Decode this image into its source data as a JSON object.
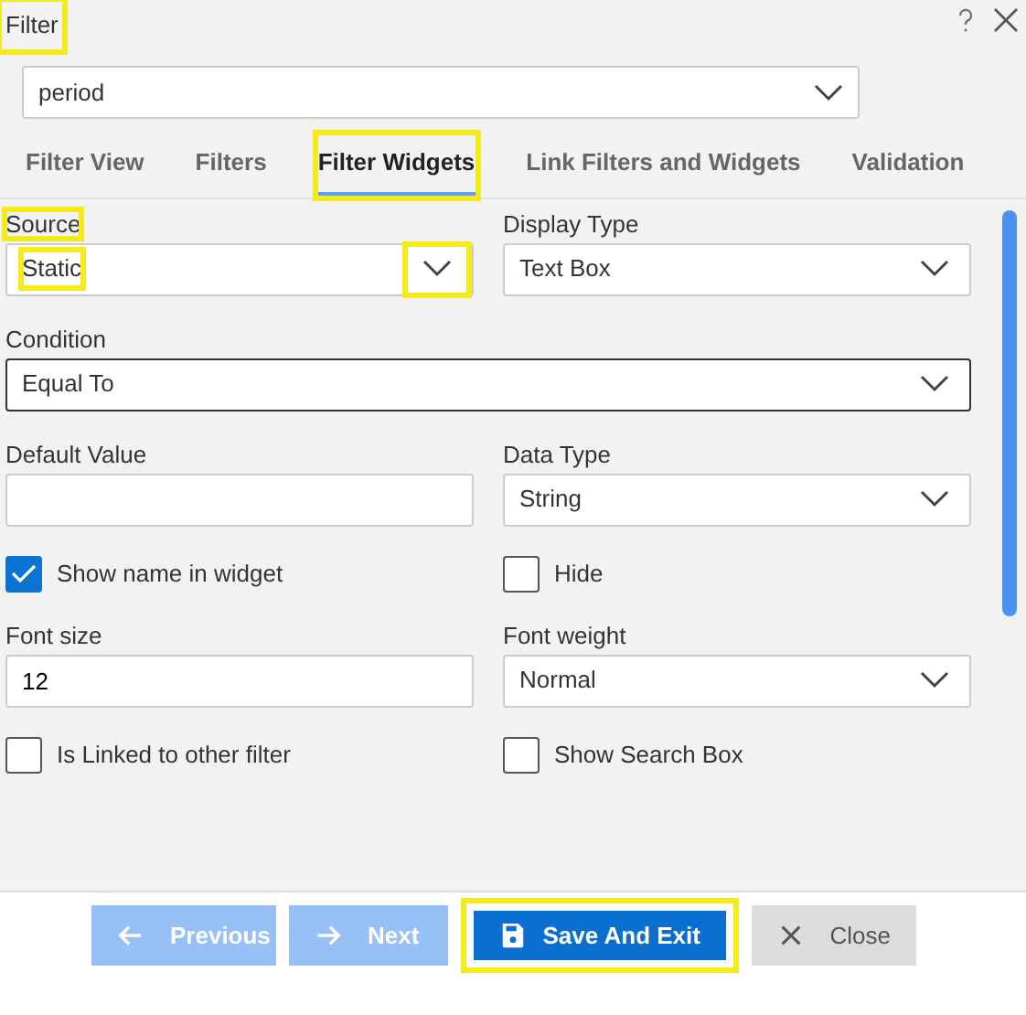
{
  "window": {
    "title": "Filter",
    "highlighted": true
  },
  "filter_select": {
    "value": "period"
  },
  "tabs": [
    {
      "label": "Filter View",
      "selected": false
    },
    {
      "label": "Filters",
      "selected": false
    },
    {
      "label": "Filter Widgets",
      "selected": true,
      "highlighted": true
    },
    {
      "label": "Link Filters and Widgets",
      "selected": false
    },
    {
      "label": "Validation",
      "selected": false
    }
  ],
  "fields": [
    {
      "kind": "select",
      "label": "Source",
      "value": "Static",
      "highlighted": true
    },
    {
      "kind": "select",
      "label": "Display Type",
      "value": "Text Box"
    },
    {
      "kind": "wide_select",
      "label": "Condition",
      "value": "Equal To",
      "focused": true
    },
    {
      "kind": "text",
      "label": "Default Value"
    },
    {
      "kind": "select",
      "label": "Data Type",
      "value": "String"
    },
    {
      "kind": "checkbox",
      "label": "Show name in widget",
      "checked": true
    },
    {
      "kind": "checkbox",
      "label": "Hide",
      "checked": false
    },
    {
      "kind": "text",
      "label": "Font size",
      "value": "12"
    },
    {
      "kind": "select",
      "label": "Font weight",
      "value": "Normal"
    },
    {
      "kind": "checkbox",
      "label": "Is Linked to other filter",
      "checked": false
    },
    {
      "kind": "checkbox",
      "label": "Show Search Box",
      "checked": false
    }
  ],
  "buttons": [
    {
      "kind": "prev",
      "label": "Previous",
      "disabled": true
    },
    {
      "kind": "next",
      "label": "Next",
      "disabled": true
    },
    {
      "kind": "save",
      "label": "Save And Exit",
      "disabled": false,
      "highlighted": true
    },
    {
      "kind": "close",
      "label": "Close",
      "disabled": false
    }
  ]
}
